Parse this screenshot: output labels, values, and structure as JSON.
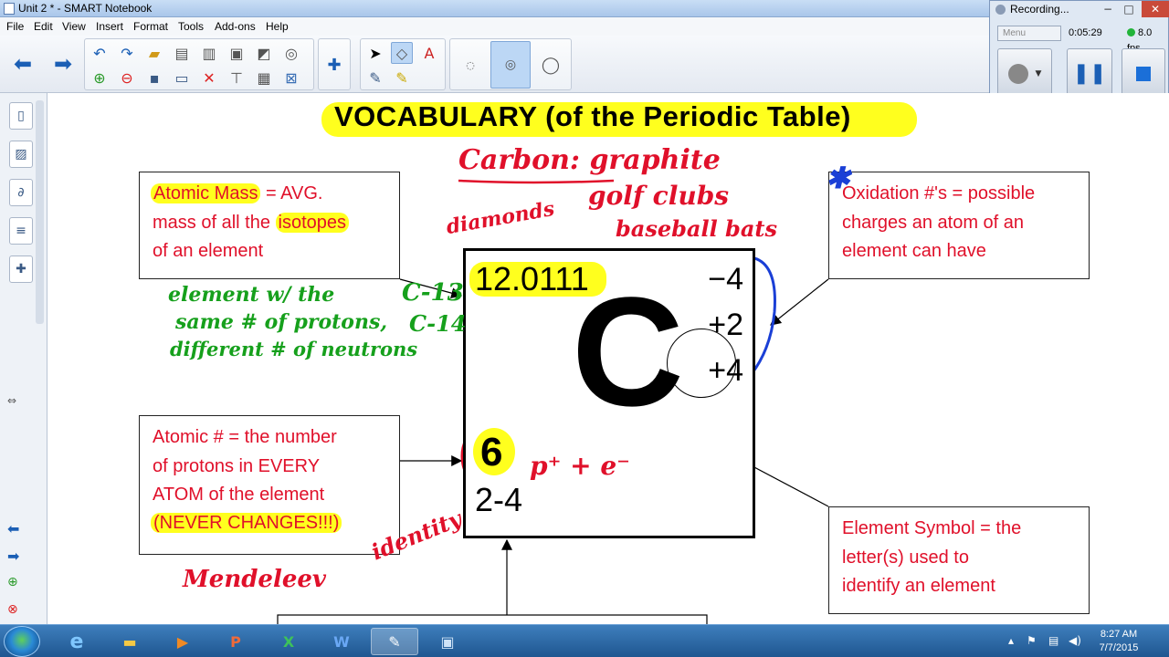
{
  "window": {
    "title": "Unit 2 * - SMART Notebook"
  },
  "menu": [
    "File",
    "Edit",
    "View",
    "Insert",
    "Format",
    "Tools",
    "Add-ons",
    "Help"
  ],
  "recorder": {
    "title": "Recording...",
    "menu_label": "Menu",
    "elapsed": "0:05:29",
    "fps": "8.0 fps"
  },
  "slide": {
    "title": "VOCABULARY (of the Periodic Table)",
    "atomic_mass_box": {
      "line1_term": "Atomic Mass",
      "line1_rest": " = AVG.",
      "line2_a": "mass of all the ",
      "line2_b": "isotopes",
      "line3": "of an element"
    },
    "oxidation_box": {
      "line1_a": "Oxidation #'s = ",
      "line1_b": "possible",
      "line2": "charges an atom of an",
      "line3": "element can have"
    },
    "atomic_number_box": {
      "line1_term": "Atomic #",
      "line1_rest": " = the number",
      "line2": "of protons in EVERY",
      "line3": "ATOM of the element",
      "line4": "(NEVER CHANGES!!!)"
    },
    "symbol_box": {
      "line1": "Element Symbol = the",
      "line2": "letter(s) used to",
      "line3": "identify an element"
    },
    "element": {
      "atomic_mass": "12.0111",
      "symbol": "C",
      "oxidation_states": [
        "−4",
        "+2",
        "+4"
      ],
      "atomic_number": "6",
      "electron_config": "2-4"
    },
    "handwriting": {
      "carbon": "Carbon: graphite",
      "diamonds": "diamonds",
      "golf": "golf clubs",
      "baseball": "baseball bats",
      "isotope_line1": "element w/ the",
      "isotope_line2": "same # of protons,",
      "isotope_line3": "different # of neutrons",
      "c13": "C-13",
      "c14": "C-14",
      "pe": "p⁺ + e⁻",
      "identity": "identity",
      "mendeleev": "Mendeleev",
      "star": "✱"
    }
  },
  "taskbar": {
    "time": "8:27 AM",
    "date": "7/7/2015"
  },
  "colors": {
    "ink_red": "#e0102a",
    "ink_green": "#16a01c",
    "ink_blue": "#1a3fd6",
    "highlight": "#ffff1e"
  }
}
